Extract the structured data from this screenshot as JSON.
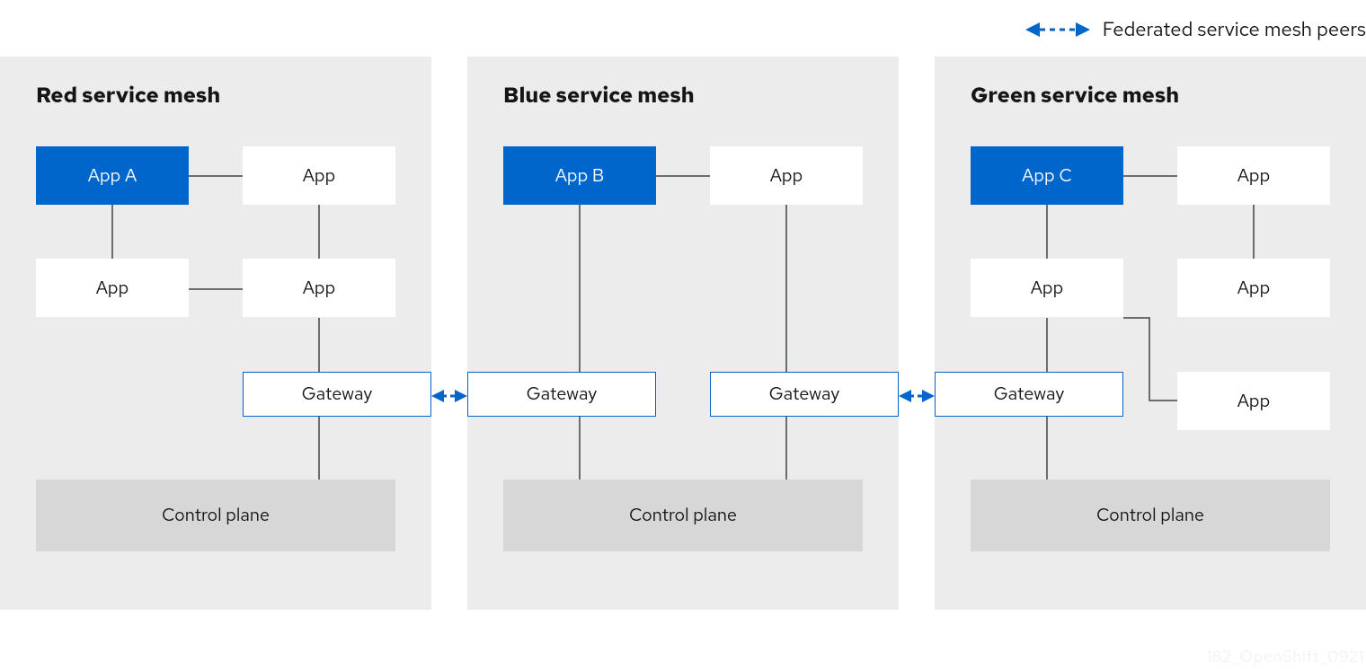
{
  "legend": "Federated service mesh peers",
  "watermark": "182_OpenShift_0921",
  "labels": {
    "app": "App",
    "gateway": "Gateway",
    "controlPlane": "Control plane"
  },
  "meshes": {
    "red": {
      "title": "Red service mesh",
      "primaryApp": "App A"
    },
    "blue": {
      "title": "Blue service mesh",
      "primaryApp": "App B"
    },
    "green": {
      "title": "Green service mesh",
      "primaryApp": "App C"
    }
  },
  "colors": {
    "primary": "#0066cc",
    "panel": "#ececec",
    "controlPlane": "#d7d7d7",
    "connector": "#6a6e73"
  }
}
